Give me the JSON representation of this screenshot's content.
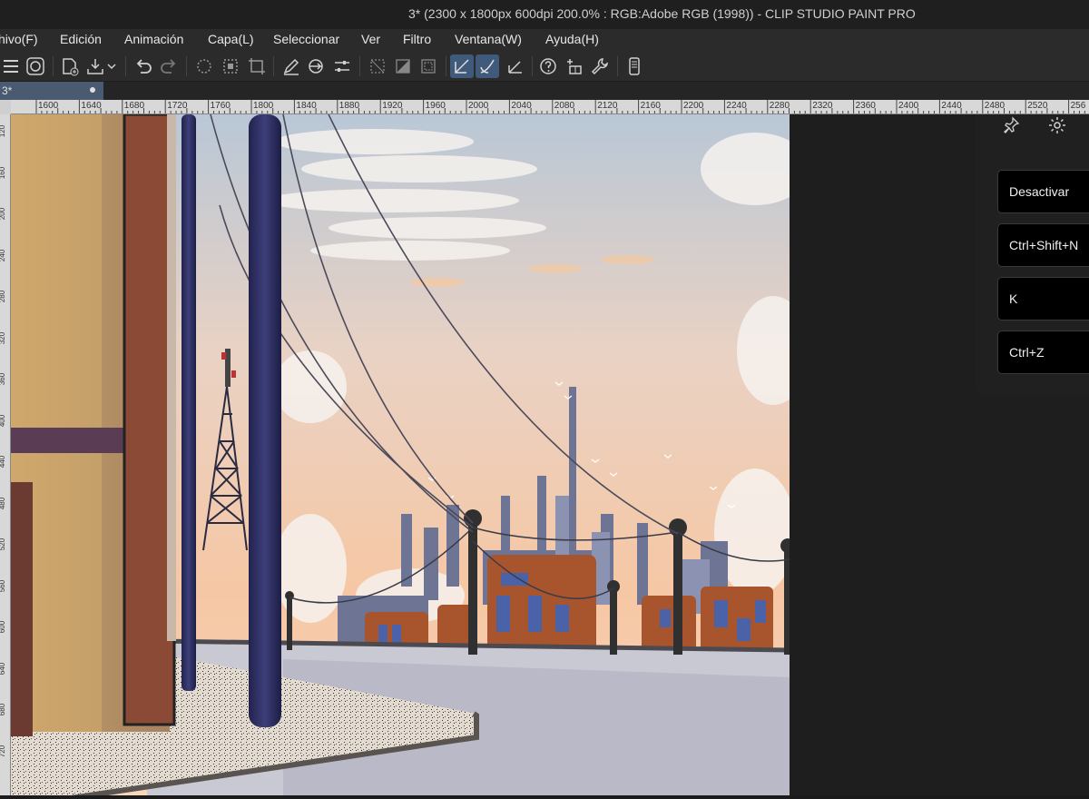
{
  "window": {
    "title": "3* (2300 x 1800px 600dpi 200.0% : RGB:Adobe RGB (1998))  - CLIP STUDIO PAINT PRO"
  },
  "menu": [
    "hivo(F)",
    "Edición",
    "Animación",
    "Capa(L)",
    "Seleccionar",
    "Ver",
    "Filtro",
    "Ventana(W)",
    "Ayuda(H)"
  ],
  "toolbar": {
    "icons": [
      "menu-icon",
      "logo-icon",
      "new-file-icon",
      "save-icon",
      "undo-icon",
      "redo-icon",
      "clear-icon",
      "fill-icon",
      "transform-icon",
      "pen-icon",
      "link-icon",
      "settings-sliders-icon",
      "select-all-icon",
      "invert-selection-icon",
      "show-selection-icon",
      "snap-ruler-icon",
      "snap-grid-icon",
      "snap-perspective-icon",
      "help-icon",
      "sparkle-icon",
      "wrench-icon",
      "phone-icon"
    ]
  },
  "tab": {
    "name": "3*"
  },
  "ruler": {
    "horizontal": [
      "1600",
      "1640",
      "1680",
      "1720",
      "1760",
      "1800",
      "1840",
      "1880",
      "1920",
      "1960",
      "2000",
      "2040",
      "2080",
      "2120",
      "2160",
      "2200",
      "2240",
      "2280",
      "2320",
      "2360",
      "2400",
      "2440",
      "2480",
      "2520",
      "256"
    ],
    "vertical": [
      "120",
      "160",
      "200",
      "240",
      "280",
      "320",
      "360",
      "400",
      "440",
      "480",
      "520",
      "560",
      "600",
      "640",
      "680",
      "720"
    ]
  },
  "shortcut_panel": {
    "icons": [
      "pin-icon",
      "gear-icon"
    ],
    "buttons": [
      "Desactivar",
      "Ctrl+Shift+N",
      "K",
      "Ctrl+Z"
    ]
  },
  "colors": {
    "accent": "#3f5a7a",
    "sky_top": "#b8c6d6",
    "sky_bottom": "#f6c7a4",
    "pole": "#2c2d5a",
    "building": "#a8552e",
    "window": "#4a62a8"
  }
}
